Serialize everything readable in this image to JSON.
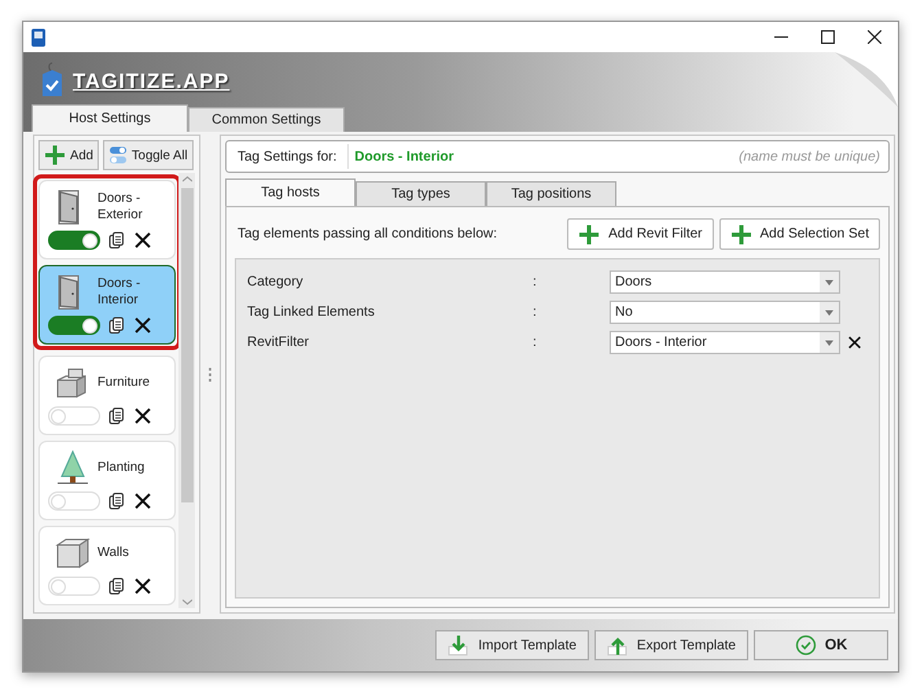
{
  "app": {
    "logo": "TAGITIZE.APP"
  },
  "tabs": [
    {
      "label": "Host Settings",
      "selected": true
    },
    {
      "label": "Common Settings",
      "selected": false
    }
  ],
  "toolbar": {
    "add": "Add",
    "toggle_all": "Toggle All"
  },
  "hosts": [
    {
      "name": "Doors - Exterior",
      "kind": "door",
      "on": true,
      "selected": false,
      "highlighted": true
    },
    {
      "name": "Doors - Interior",
      "kind": "door",
      "on": true,
      "selected": true,
      "highlighted": true
    },
    {
      "name": "Furniture",
      "kind": "furniture",
      "on": false,
      "selected": false,
      "highlighted": false
    },
    {
      "name": "Planting",
      "kind": "planting",
      "on": false,
      "selected": false,
      "highlighted": false
    },
    {
      "name": "Walls",
      "kind": "wall",
      "on": false,
      "selected": false,
      "highlighted": false
    }
  ],
  "tag_settings": {
    "label": "Tag Settings for:",
    "value": "Doors - Interior",
    "note": "(name must be unique)"
  },
  "inner_tabs": [
    {
      "label": "Tag hosts",
      "selected": true
    },
    {
      "label": "Tag types",
      "selected": false
    },
    {
      "label": "Tag positions",
      "selected": false
    }
  ],
  "instruction": "Tag elements passing all conditions below:",
  "filter_buttons": [
    "Add Revit Filter",
    "Add Selection Set"
  ],
  "conditions": [
    {
      "label": "Category",
      "separator": ":",
      "value": "Doors",
      "removable": false
    },
    {
      "label": "Tag Linked Elements",
      "separator": ":",
      "value": "No",
      "removable": false
    },
    {
      "label": "RevitFilter",
      "separator": ":",
      "value": "Doors - Interior",
      "removable": true
    }
  ],
  "footer": [
    {
      "label": "Import Template",
      "kind": "import"
    },
    {
      "label": "Export Template",
      "kind": "export"
    },
    {
      "label": "OK",
      "kind": "ok"
    }
  ]
}
